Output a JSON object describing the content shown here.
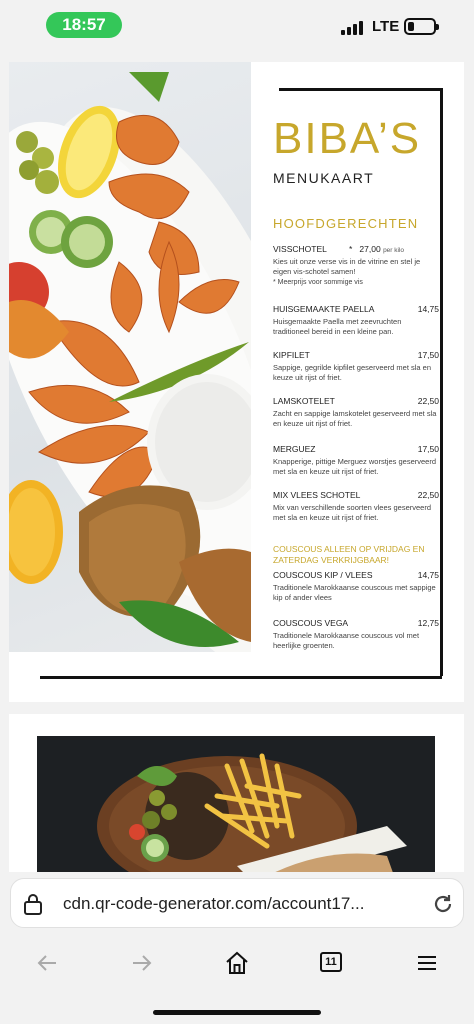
{
  "status": {
    "time": "18:57",
    "network": "LTE",
    "battery_level": 0.25
  },
  "menu_card": {
    "brand": "BIBA’S",
    "subtitle": "MENUKAART",
    "section_title": "HOOFDGERECHTEN",
    "visschotel": {
      "name": "VISSCHOTEL",
      "star": "*",
      "price": "27,00",
      "unit": "per kilo",
      "desc": "Kies uit onze verse vis in de vitrine en stel je eigen vis-schotel samen!",
      "note": "*     Meerprijs voor sommige vis"
    },
    "items": [
      {
        "name": "HUISGEMAAKTE PAELLA",
        "price": "14,75",
        "desc": "Huisgemaakte Paella met zeevruchten traditioneel bereid in een kleine pan."
      },
      {
        "name": "KIPFILET",
        "price": "17,50",
        "desc": "Sappige, gegrilde kipfilet geserveerd met sla en keuze uit rijst of friet."
      },
      {
        "name": "LAMSKOTELET",
        "price": "22,50",
        "desc": "Zacht en sappige lamskotelet geserveerd met sla en keuze uit rijst of friet."
      },
      {
        "name": "MERGUEZ",
        "price": "17,50",
        "desc": "Knapperige, pittige Merguez worstjes geserveerd met sla en keuze uit rijst of friet."
      },
      {
        "name": "MIX VLEES SCHOTEL",
        "price": "22,50",
        "desc": "Mix van verschillende soorten vlees geserveerd met sla en keuze uit rijst of friet."
      }
    ],
    "couscous_note": "COUSCOUS ALLEEN OP VRIJDAG EN ZATERDAG VERKRIJGBAAR!",
    "couscous_items": [
      {
        "name": "COUSCOUS KIP / VLEES",
        "price": "14,75",
        "desc": "Traditionele Marokkaanse couscous met sappige kip of ander vlees"
      },
      {
        "name": "COUSCOUS VEGA",
        "price": "12,75",
        "desc": "Traditionele Marokkaanse couscous vol met heerlijke groenten."
      }
    ]
  },
  "browser": {
    "url": "cdn.qr-code-generator.com/account17...",
    "tab_count": "11",
    "icons": [
      "lock-icon",
      "reload-icon",
      "back-arrow-icon",
      "forward-arrow-icon",
      "home-icon",
      "tabs-icon",
      "menu-icon"
    ]
  },
  "colors": {
    "accent_gold": "#c7a72c",
    "status_green": "#34c759"
  }
}
